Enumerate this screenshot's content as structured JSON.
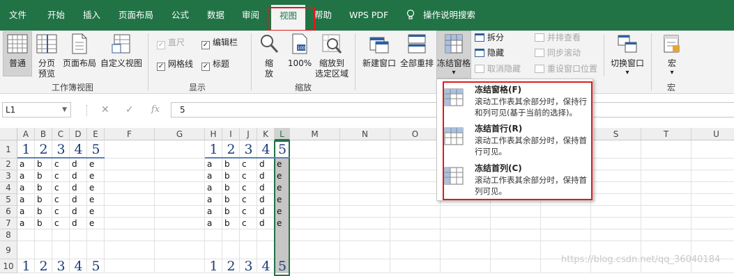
{
  "tabs": [
    "文件",
    "开始",
    "插入",
    "页面布局",
    "公式",
    "数据",
    "审阅",
    "视图",
    "帮助",
    "WPS PDF",
    "操作说明搜索"
  ],
  "ribbon": {
    "workbook_views": {
      "normal": "普通",
      "page_break_1": "分页",
      "page_break_2": "预览",
      "page_layout": "页面布局",
      "custom_view": "自定义视图",
      "group_label": "工作簿视图"
    },
    "show": {
      "ruler": "直尺",
      "formula_bar": "编辑栏",
      "gridlines": "网格线",
      "headings": "标题",
      "group_label": "显示"
    },
    "zoom": {
      "zoom_1": "缩",
      "zoom_2": "放",
      "hundred": "100%",
      "zoom_sel_1": "缩放到",
      "zoom_sel_2": "选定区域",
      "group_label": "缩放"
    },
    "window": {
      "new_window": "新建窗口",
      "arrange_all": "全部重排",
      "freeze_panes": "冻结窗格",
      "freeze_arrow": "▾",
      "split": "拆分",
      "hide": "隐藏",
      "unhide": "取消隐藏",
      "side_by_side": "并排查看",
      "sync_scroll": "同步滚动",
      "reset_pos": "重设窗口位置",
      "switch_windows": "切换窗口",
      "switch_arrow": "▾"
    },
    "macros": {
      "label": "宏",
      "arrow": "▾",
      "group_label": "宏"
    }
  },
  "formula_bar": {
    "name_box": "L1",
    "cancel": "✕",
    "enter": "✓",
    "fx": "fx",
    "value": "5"
  },
  "columns": [
    "A",
    "B",
    "C",
    "D",
    "E",
    "F",
    "G",
    "H",
    "I",
    "J",
    "K",
    "L",
    "M",
    "N",
    "O",
    "P",
    "Q",
    "R",
    "S",
    "T",
    "U"
  ],
  "rows": [
    "1",
    "2",
    "3",
    "4",
    "5",
    "6",
    "7",
    "8",
    "9",
    "10"
  ],
  "cells": {
    "header_numbers": [
      "1",
      "2",
      "3",
      "4",
      "5"
    ],
    "letters": [
      "a",
      "b",
      "c",
      "d",
      "e"
    ]
  },
  "dropdown": {
    "items": [
      {
        "title": "冻结窗格(F)",
        "desc": "滚动工作表其余部分时，保持行和列可见(基于当前的选择)。"
      },
      {
        "title": "冻结首行(R)",
        "desc": "滚动工作表其余部分时，保持首行可见。"
      },
      {
        "title": "冻结首列(C)",
        "desc": "滚动工作表其余部分时，保持首列可见。"
      }
    ]
  },
  "watermark": "https://blog.csdn.net/qq_36040184",
  "colors": {
    "accent": "#217346",
    "highlight": "#e01a1a",
    "number_blue": "#1f3c78"
  }
}
